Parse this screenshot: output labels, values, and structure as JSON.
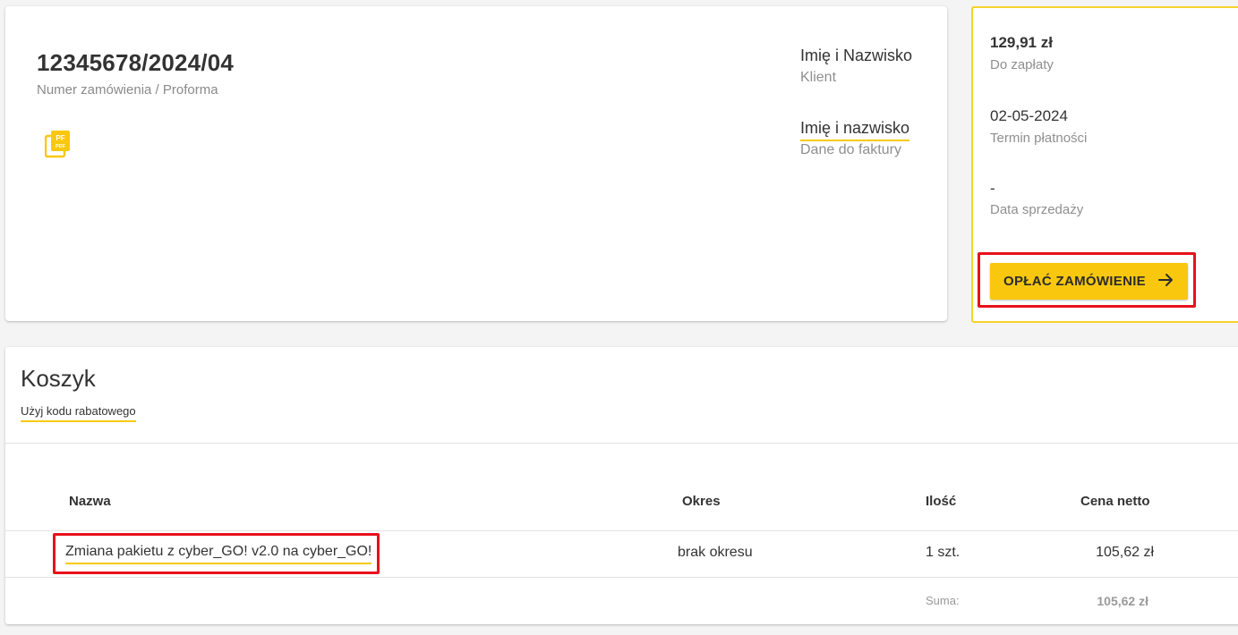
{
  "order": {
    "number": "12345678/2024/04",
    "subtitle": "Numer zamówienia / Proforma",
    "pdf_icon": "pdf-document-icon",
    "client_name": "Imię i Nazwisko",
    "client_label": "Klient",
    "invoice_name": "Imię i nazwisko",
    "invoice_label": "Dane do faktury"
  },
  "payment": {
    "amount": "129,91 zł",
    "amount_label": "Do zapłaty",
    "due_date": "02-05-2024",
    "due_date_label": "Termin płatności",
    "sale_date": "-",
    "sale_date_label": "Data sprzedaży",
    "button_label": "OPŁAĆ ZAMÓWIENIE",
    "button_icon": "arrow-right-icon"
  },
  "cart": {
    "title": "Koszyk",
    "discount_link": "Użyj kodu rabatowego",
    "columns": [
      "Nazwa",
      "Okres",
      "Ilość",
      "Cena netto"
    ],
    "rows": [
      {
        "name": "Zmiana pakietu z cyber_GO! v2.0 na cyber_GO!",
        "period": "brak okresu",
        "quantity": "1 szt.",
        "price": "105,62 zł"
      }
    ],
    "sum_label": "Suma:",
    "sum_value": "105,62 zł"
  },
  "colors": {
    "accent": "#f9c80e",
    "highlight": "#e8111b",
    "background": "#f4f4f4"
  }
}
